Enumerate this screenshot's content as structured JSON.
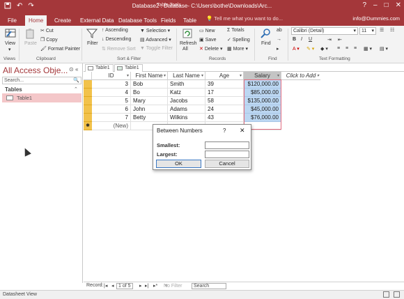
{
  "titlebar": {
    "context_tab": "Table Tools",
    "title": "Database2 : Database- C:\\Users\\bothe\\Downloads\\Arc...",
    "quick_access": [
      "save-icon",
      "undo-icon",
      "redo-icon"
    ],
    "window_controls": [
      "?",
      "–",
      "□",
      "✕"
    ]
  },
  "tabs": {
    "items": [
      "File",
      "Home",
      "Create",
      "External Data",
      "Database Tools",
      "Fields",
      "Table"
    ],
    "active": "Home",
    "tell_me": "Tell me what you want to do...",
    "account": "info@Dummies.com"
  },
  "ribbon": {
    "views": {
      "view": "View",
      "label": "Views"
    },
    "clipboard": {
      "paste": "Paste",
      "cut": "Cut",
      "copy": "Copy",
      "format_painter": "Format Painter",
      "label": "Clipboard"
    },
    "sort_filter": {
      "filter": "Filter",
      "ascending": "Ascending",
      "descending": "Descending",
      "remove_sort": "Remove Sort",
      "selection": "Selection",
      "advanced": "Advanced",
      "toggle_filter": "Toggle Filter",
      "label": "Sort & Filter"
    },
    "records": {
      "refresh": "Refresh",
      "refresh_all": "All",
      "new": "New",
      "save": "Save",
      "delete": "Delete",
      "totals": "Totals",
      "spelling": "Spelling",
      "more": "More",
      "label": "Records"
    },
    "find": {
      "find": "Find",
      "label": "Find"
    },
    "text_formatting": {
      "font": "Calibri (Detail)",
      "size": "11",
      "label": "Text Formatting"
    }
  },
  "navpane": {
    "title": "All Access Obje...",
    "search_placeholder": "Search...",
    "category": "Tables",
    "items": [
      {
        "label": "Table1"
      }
    ]
  },
  "doctabs": [
    {
      "label": "Table1"
    },
    {
      "label": "Table1"
    }
  ],
  "datasheet": {
    "columns": [
      "ID",
      "First Name",
      "Last Name",
      "Age",
      "Salary",
      "Click to Add"
    ],
    "rows": [
      {
        "id": "3",
        "first": "Bob",
        "last": "Smith",
        "age": "39",
        "salary": "$120,000.00"
      },
      {
        "id": "4",
        "first": "Bo",
        "last": "Katz",
        "age": "17",
        "salary": "$85,000.00"
      },
      {
        "id": "5",
        "first": "Mary",
        "last": "Jacobs",
        "age": "58",
        "salary": "$135,000.00"
      },
      {
        "id": "6",
        "first": "John",
        "last": "Adams",
        "age": "24",
        "salary": "$45,000.00"
      },
      {
        "id": "7",
        "first": "Betty",
        "last": "Wilkins",
        "age": "43",
        "salary": "$76,000.00"
      }
    ],
    "new_row_label": "(New)"
  },
  "dialog": {
    "title": "Between Numbers",
    "help": "?",
    "close": "✕",
    "smallest_label": "Smallest:",
    "largest_label": "Largest:",
    "smallest_value": "",
    "largest_value": "",
    "ok": "OK",
    "cancel": "Cancel"
  },
  "record_nav": {
    "label": "Record:",
    "position": "1 of 5",
    "filter": "No Filter",
    "search": "Search"
  },
  "statusbar": {
    "view": "Datasheet View"
  },
  "colors": {
    "accent": "#a4373a",
    "selected_column": "#bcd7f2",
    "record_selector": "#f2c24b"
  }
}
